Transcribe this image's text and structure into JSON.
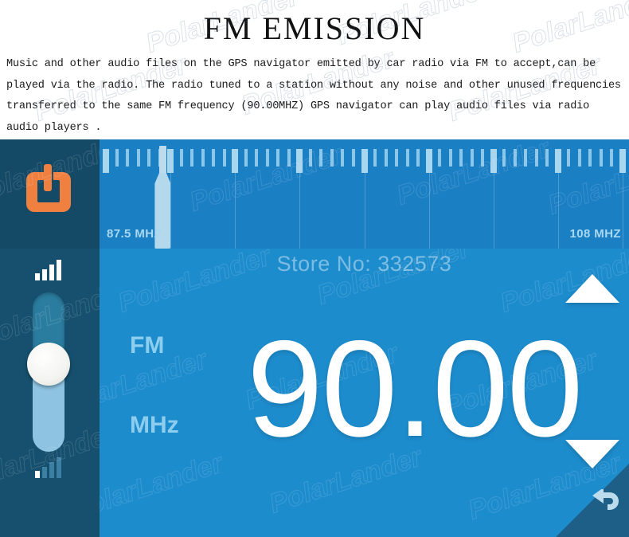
{
  "header": {
    "title": "FM EMISSION",
    "description": "Music and other audio files on the GPS navigator emitted by car radio via FM to accept,can be played via the radio. The radio tuned to a station without any noise and other unused frequencies transferred to the same FM frequency (90.00MHZ) GPS navigator can play audio files via radio audio players ."
  },
  "device": {
    "sidebar": {
      "power_icon": "power-icon",
      "volume": {
        "max_icon": "signal-bars-max-icon",
        "min_icon": "signal-bars-min-icon",
        "value": 55
      }
    },
    "tuner": {
      "min_label": "87.5 MHZ",
      "max_label": "108 MHZ",
      "needle_position_percent": 11
    },
    "display": {
      "band": "FM",
      "unit": "MHz",
      "frequency": "90.00",
      "up_icon": "triangle-up-icon",
      "down_icon": "triangle-down-icon",
      "back_icon": "back-arrow-icon"
    }
  },
  "watermarks": {
    "store_no": "Store No: 332573",
    "brand": "PolarLander"
  },
  "colors": {
    "sidebar": "#16506e",
    "power_panel": "#154a67",
    "tuner_bg": "#1b7fc4",
    "display_bg": "#1d8ccd",
    "accent_orange": "#f08040",
    "label_blue": "#8dcdee",
    "back_corner": "#1d5f87"
  }
}
